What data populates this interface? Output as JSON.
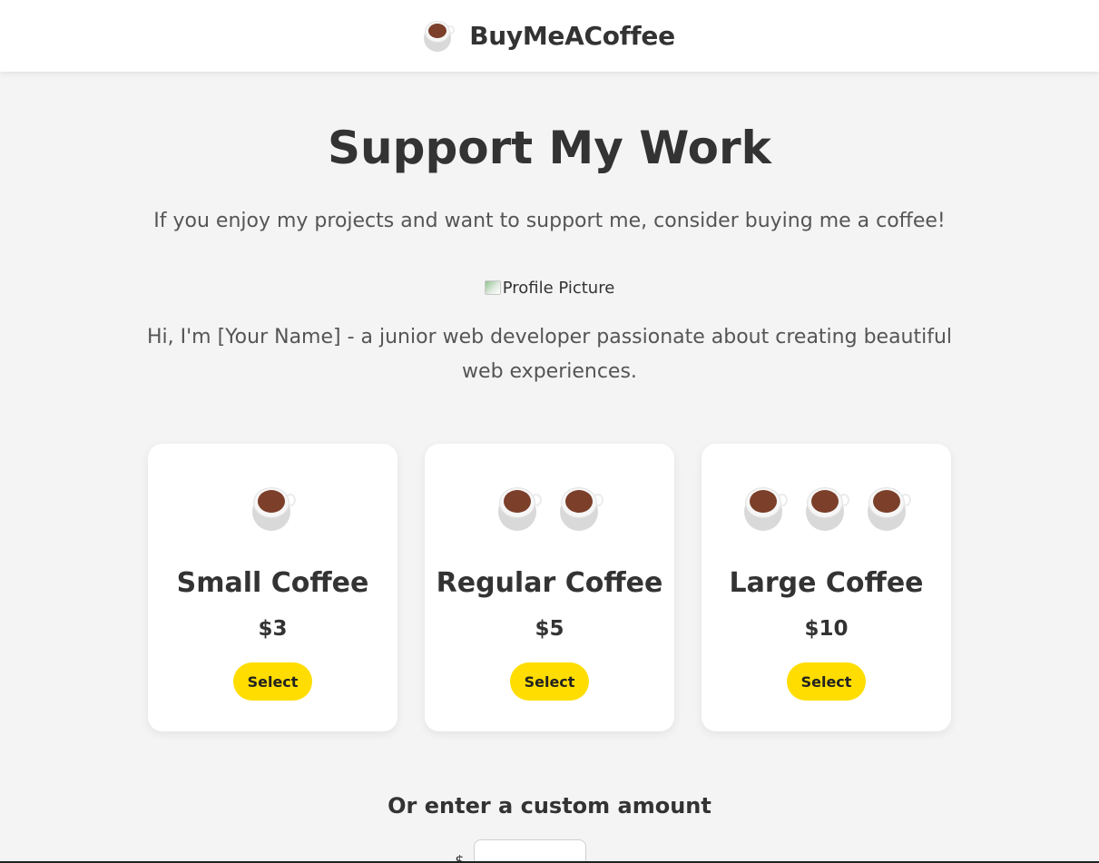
{
  "header": {
    "brand": "BuyMeACoffee",
    "logo_icon": "coffee-cup-icon"
  },
  "main": {
    "title": "Support My Work",
    "intro": "If you enjoy my projects and want to support me, consider buying me a coffee!",
    "profile_alt": "Profile Picture",
    "bio": "Hi, I'm [Your Name] - a junior web developer passionate about creating beautiful web experiences."
  },
  "tiers": [
    {
      "cups": 1,
      "name": "Small Coffee",
      "price": "$3",
      "button": "Select"
    },
    {
      "cups": 2,
      "name": "Regular Coffee",
      "price": "$5",
      "button": "Select"
    },
    {
      "cups": 3,
      "name": "Large Coffee",
      "price": "$10",
      "button": "Select"
    }
  ],
  "custom": {
    "heading": "Or enter a custom amount",
    "currency": "$",
    "input_value": "",
    "input_placeholder": ""
  },
  "colors": {
    "accent": "#FFDD00",
    "coffee": "#7B3F2A",
    "background": "#F4F4F4"
  }
}
